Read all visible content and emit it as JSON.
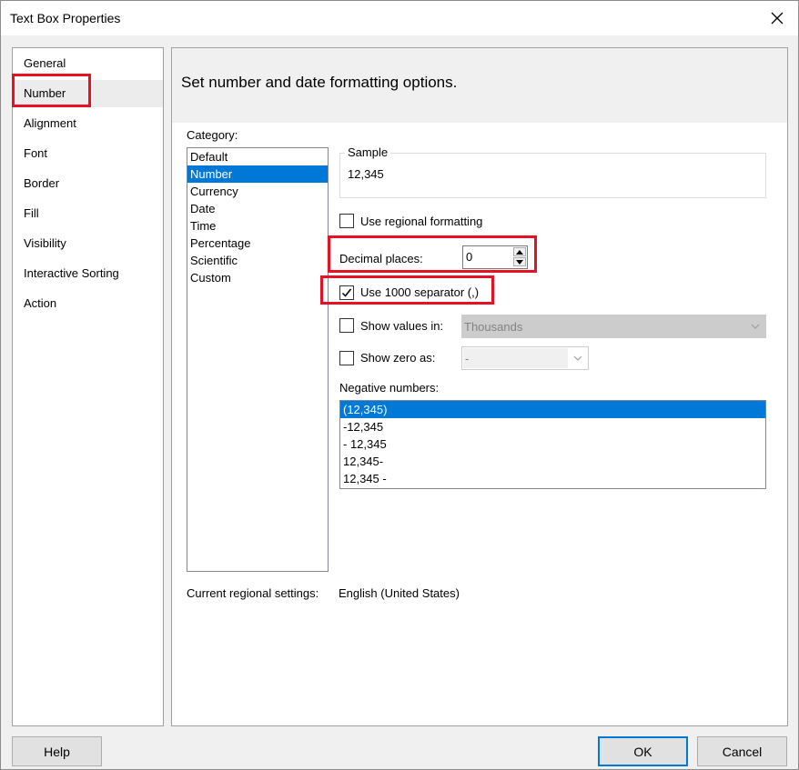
{
  "window": {
    "title": "Text Box Properties",
    "close_icon": "close-icon"
  },
  "nav": {
    "items": [
      {
        "label": "General"
      },
      {
        "label": "Number"
      },
      {
        "label": "Alignment"
      },
      {
        "label": "Font"
      },
      {
        "label": "Border"
      },
      {
        "label": "Fill"
      },
      {
        "label": "Visibility"
      },
      {
        "label": "Interactive Sorting"
      },
      {
        "label": "Action"
      }
    ],
    "selected": "Number"
  },
  "header": {
    "text": "Set number and date formatting options."
  },
  "category": {
    "label": "Category:",
    "items": [
      "Default",
      "Number",
      "Currency",
      "Date",
      "Time",
      "Percentage",
      "Scientific",
      "Custom"
    ],
    "selected": "Number"
  },
  "sample": {
    "label": "Sample",
    "value": "12,345"
  },
  "regional": {
    "label": "Use regional formatting",
    "checked": false
  },
  "decimal": {
    "label": "Decimal places:",
    "value": "0"
  },
  "separator": {
    "label": "Use 1000 separator (,)",
    "checked": true
  },
  "show_values": {
    "label": "Show values in:",
    "checked": false,
    "value": "Thousands"
  },
  "show_zero": {
    "label": "Show zero as:",
    "checked": false,
    "value": "-"
  },
  "negative": {
    "label": "Negative numbers:",
    "items": [
      "(12,345)",
      "-12,345",
      "- 12,345",
      "12,345-",
      "12,345 -"
    ],
    "selected": "(12,345)"
  },
  "regional_settings": {
    "label": "Current regional settings:",
    "value": "English (United States)"
  },
  "buttons": {
    "help": "Help",
    "ok": "OK",
    "cancel": "Cancel"
  },
  "colors": {
    "accent": "#0078d7",
    "highlight": "#e81123"
  }
}
